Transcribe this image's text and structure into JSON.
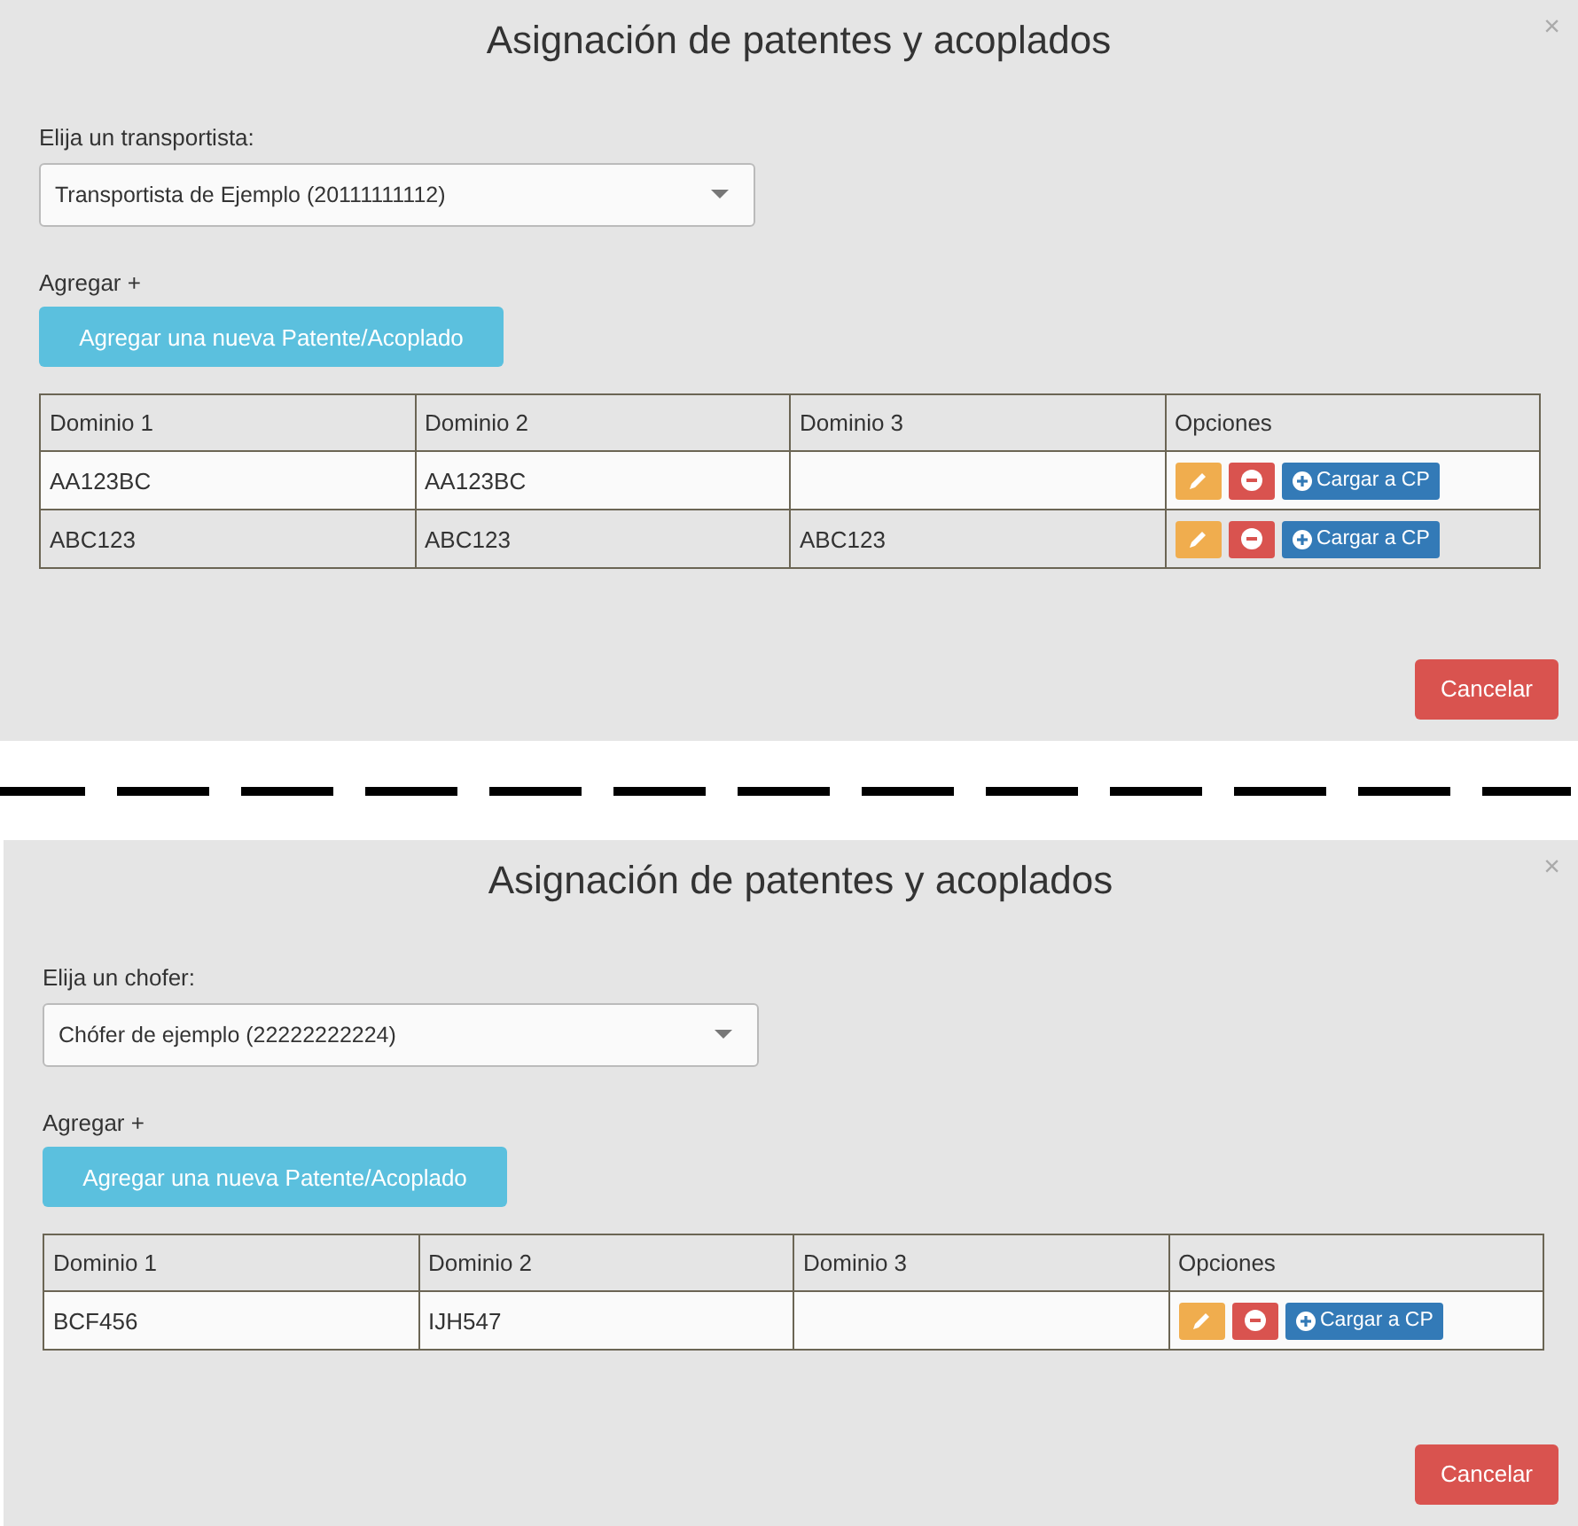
{
  "panels": [
    {
      "title": "Asignación de patentes y acoplados",
      "close": "×",
      "select_label": "Elija un transportista:",
      "select_value": "Transportista de Ejemplo (20111111112)",
      "add_label": "Agregar +",
      "add_button": "Agregar una nueva Patente/Acoplado",
      "columns": [
        "Dominio 1",
        "Dominio 2",
        "Dominio 3",
        "Opciones"
      ],
      "rows": [
        {
          "cells": [
            "AA123BC",
            "AA123BC",
            ""
          ],
          "action": "Cargar a CP"
        },
        {
          "cells": [
            "ABC123",
            "ABC123",
            "ABC123"
          ],
          "action": "Cargar a CP"
        }
      ],
      "cancel": "Cancelar"
    },
    {
      "title": "Asignación de patentes y acoplados",
      "close": "×",
      "select_label": "Elija un chofer:",
      "select_value": "Chófer de ejemplo (22222222224)",
      "add_label": "Agregar +",
      "add_button": "Agregar una nueva Patente/Acoplado",
      "columns": [
        "Dominio 1",
        "Dominio 2",
        "Dominio 3",
        "Opciones"
      ],
      "rows": [
        {
          "cells": [
            "BCF456",
            "IJH547",
            ""
          ],
          "action": "Cargar a CP"
        }
      ],
      "cancel": "Cancelar"
    }
  ]
}
